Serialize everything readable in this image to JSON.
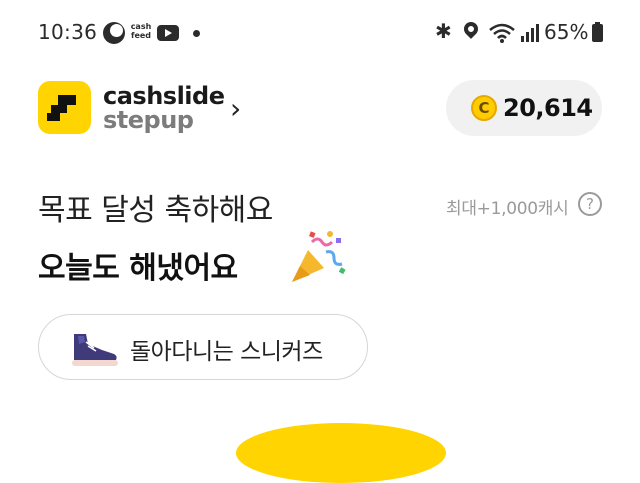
{
  "status_bar": {
    "time": "10:36",
    "notification_icons": [
      "moon-icon",
      "cashfeed-icon",
      "youtube-icon",
      "dot-icon"
    ],
    "cashfeed_text": "cash feed",
    "system_icons": [
      "bluetooth-icon",
      "location-icon",
      "wifi-icon",
      "signal-icon",
      "battery-icon"
    ],
    "battery": "65%"
  },
  "header": {
    "brand_line1": "cashslide",
    "brand_line2": "stepup",
    "chevron": "›",
    "coin_symbol": "C",
    "coin_balance": "20,614"
  },
  "goal": {
    "line1": "목표 달성 축하해요",
    "line2": "오늘도 해냈어요",
    "max_reward": "최대+1,000캐시",
    "help_symbol": "?"
  },
  "item": {
    "label": "돌아다니는 스니커즈"
  },
  "colors": {
    "brand_yellow": "#ffd400",
    "brand_dark": "#1a1a1a",
    "muted": "#9a9a9a",
    "pill_bg": "#f1f1f1"
  }
}
